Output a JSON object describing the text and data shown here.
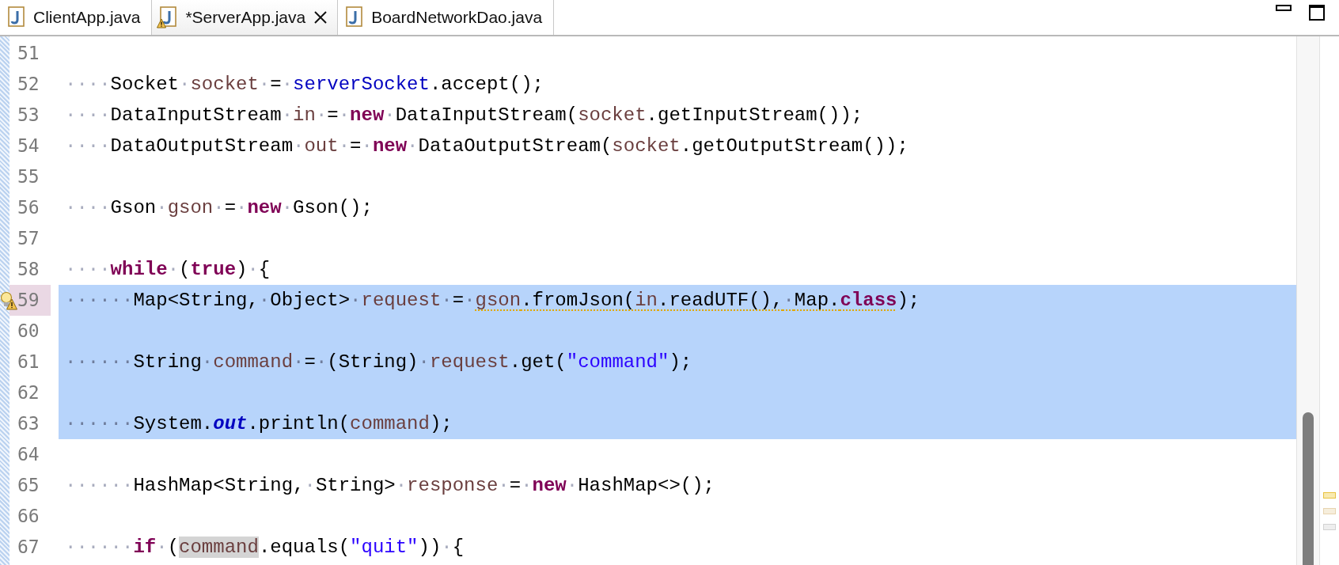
{
  "tabs": [
    {
      "label": "ClientApp.java",
      "selected": false,
      "warning": false
    },
    {
      "label": "*ServerApp.java",
      "selected": true,
      "warning": true
    },
    {
      "label": "BoardNetworkDao.java",
      "selected": false,
      "warning": false
    }
  ],
  "editor": {
    "lines": [
      {
        "number": "51",
        "selected": false,
        "warning": false
      },
      {
        "number": "52",
        "selected": false,
        "warning": false,
        "tokens": [
          {
            "kind": "ws",
            "text": "····"
          },
          {
            "kind": "plain",
            "text": "Socket"
          },
          {
            "kind": "ws",
            "text": "·"
          },
          {
            "kind": "local",
            "text": "socket"
          },
          {
            "kind": "ws",
            "text": "·"
          },
          {
            "kind": "plain",
            "text": "="
          },
          {
            "kind": "ws",
            "text": "·"
          },
          {
            "kind": "field",
            "text": "serverSocket"
          },
          {
            "kind": "plain",
            "text": ".accept();"
          }
        ]
      },
      {
        "number": "53",
        "selected": false,
        "warning": false,
        "tokens": [
          {
            "kind": "ws",
            "text": "····"
          },
          {
            "kind": "plain",
            "text": "DataInputStream"
          },
          {
            "kind": "ws",
            "text": "·"
          },
          {
            "kind": "local",
            "text": "in"
          },
          {
            "kind": "ws",
            "text": "·"
          },
          {
            "kind": "plain",
            "text": "="
          },
          {
            "kind": "ws",
            "text": "·"
          },
          {
            "kind": "keyword",
            "text": "new"
          },
          {
            "kind": "ws",
            "text": "·"
          },
          {
            "kind": "plain",
            "text": "DataInputStream("
          },
          {
            "kind": "local",
            "text": "socket"
          },
          {
            "kind": "plain",
            "text": ".getInputStream());"
          }
        ]
      },
      {
        "number": "54",
        "selected": false,
        "warning": false,
        "tokens": [
          {
            "kind": "ws",
            "text": "····"
          },
          {
            "kind": "plain",
            "text": "DataOutputStream"
          },
          {
            "kind": "ws",
            "text": "·"
          },
          {
            "kind": "local",
            "text": "out"
          },
          {
            "kind": "ws",
            "text": "·"
          },
          {
            "kind": "plain",
            "text": "="
          },
          {
            "kind": "ws",
            "text": "·"
          },
          {
            "kind": "keyword",
            "text": "new"
          },
          {
            "kind": "ws",
            "text": "·"
          },
          {
            "kind": "plain",
            "text": "DataOutputStream("
          },
          {
            "kind": "local",
            "text": "socket"
          },
          {
            "kind": "plain",
            "text": ".getOutputStream());"
          }
        ]
      },
      {
        "number": "55",
        "selected": false,
        "warning": false
      },
      {
        "number": "56",
        "selected": false,
        "warning": false,
        "tokens": [
          {
            "kind": "ws",
            "text": "····"
          },
          {
            "kind": "plain",
            "text": "Gson"
          },
          {
            "kind": "ws",
            "text": "·"
          },
          {
            "kind": "local",
            "text": "gson"
          },
          {
            "kind": "ws",
            "text": "·"
          },
          {
            "kind": "plain",
            "text": "="
          },
          {
            "kind": "ws",
            "text": "·"
          },
          {
            "kind": "keyword",
            "text": "new"
          },
          {
            "kind": "ws",
            "text": "·"
          },
          {
            "kind": "plain",
            "text": "Gson();"
          }
        ]
      },
      {
        "number": "57",
        "selected": false,
        "warning": false
      },
      {
        "number": "58",
        "selected": false,
        "warning": false,
        "tokens": [
          {
            "kind": "ws",
            "text": "····"
          },
          {
            "kind": "keyword",
            "text": "while"
          },
          {
            "kind": "ws",
            "text": "·"
          },
          {
            "kind": "plain",
            "text": "("
          },
          {
            "kind": "keyword",
            "text": "true"
          },
          {
            "kind": "plain",
            "text": ")"
          },
          {
            "kind": "ws",
            "text": "·"
          },
          {
            "kind": "plain",
            "text": "{"
          }
        ]
      },
      {
        "number": "59",
        "selected": true,
        "warning": true,
        "tokens": [
          {
            "kind": "ws",
            "text": "······"
          },
          {
            "kind": "plain",
            "text": "Map<String,"
          },
          {
            "kind": "ws",
            "text": "·"
          },
          {
            "kind": "plain",
            "text": "Object>"
          },
          {
            "kind": "ws",
            "text": "·"
          },
          {
            "kind": "local",
            "text": "request"
          },
          {
            "kind": "ws",
            "text": "·"
          },
          {
            "kind": "plain",
            "text": "="
          },
          {
            "kind": "ws",
            "text": "·"
          },
          {
            "kind": "warning",
            "tokens": [
              {
                "kind": "local",
                "text": "gson"
              },
              {
                "kind": "plain",
                "text": ".fromJson("
              },
              {
                "kind": "local",
                "text": "in"
              },
              {
                "kind": "plain",
                "text": ".readUTF(),"
              },
              {
                "kind": "ws",
                "text": "·"
              },
              {
                "kind": "plain",
                "text": "Map."
              },
              {
                "kind": "keyword",
                "text": "class"
              }
            ]
          },
          {
            "kind": "plain",
            "text": ");"
          }
        ]
      },
      {
        "number": "60",
        "selected": true,
        "warning": false
      },
      {
        "number": "61",
        "selected": true,
        "warning": false,
        "tokens": [
          {
            "kind": "ws",
            "text": "······"
          },
          {
            "kind": "plain",
            "text": "String"
          },
          {
            "kind": "ws",
            "text": "·"
          },
          {
            "kind": "local",
            "text": "command"
          },
          {
            "kind": "ws",
            "text": "·"
          },
          {
            "kind": "plain",
            "text": "="
          },
          {
            "kind": "ws",
            "text": "·"
          },
          {
            "kind": "plain",
            "text": "(String)"
          },
          {
            "kind": "ws",
            "text": "·"
          },
          {
            "kind": "local",
            "text": "request"
          },
          {
            "kind": "plain",
            "text": ".get("
          },
          {
            "kind": "string",
            "text": "\"command\""
          },
          {
            "kind": "plain",
            "text": ");"
          }
        ]
      },
      {
        "number": "62",
        "selected": true,
        "warning": false
      },
      {
        "number": "63",
        "selected": true,
        "warning": false,
        "tokens": [
          {
            "kind": "ws",
            "text": "······"
          },
          {
            "kind": "plain",
            "text": "System."
          },
          {
            "kind": "static",
            "text": "out"
          },
          {
            "kind": "plain",
            "text": ".println("
          },
          {
            "kind": "local",
            "text": "command"
          },
          {
            "kind": "plain",
            "text": ");"
          }
        ]
      },
      {
        "number": "64",
        "selected": false,
        "warning": false
      },
      {
        "number": "65",
        "selected": false,
        "warning": false,
        "tokens": [
          {
            "kind": "ws",
            "text": "······"
          },
          {
            "kind": "plain",
            "text": "HashMap<String,"
          },
          {
            "kind": "ws",
            "text": "·"
          },
          {
            "kind": "plain",
            "text": "String>"
          },
          {
            "kind": "ws",
            "text": "·"
          },
          {
            "kind": "local",
            "text": "response"
          },
          {
            "kind": "ws",
            "text": "·"
          },
          {
            "kind": "plain",
            "text": "="
          },
          {
            "kind": "ws",
            "text": "·"
          },
          {
            "kind": "keyword",
            "text": "new"
          },
          {
            "kind": "ws",
            "text": "·"
          },
          {
            "kind": "plain",
            "text": "HashMap<>();"
          }
        ]
      },
      {
        "number": "66",
        "selected": false,
        "warning": false
      },
      {
        "number": "67",
        "selected": false,
        "warning": false,
        "tokens": [
          {
            "kind": "ws",
            "text": "······"
          },
          {
            "kind": "keyword",
            "text": "if"
          },
          {
            "kind": "ws",
            "text": "·"
          },
          {
            "kind": "plain",
            "text": "("
          },
          {
            "kind": "occurrence",
            "text": "command"
          },
          {
            "kind": "plain",
            "text": ".equals("
          },
          {
            "kind": "string",
            "text": "\"quit\""
          },
          {
            "kind": "plain",
            "text": "))"
          },
          {
            "kind": "ws",
            "text": "·"
          },
          {
            "kind": "plain",
            "text": "{"
          }
        ]
      }
    ],
    "overview_markers": [
      {
        "kind": "warning"
      },
      {
        "kind": "occurrence"
      },
      {
        "kind": "annotation"
      }
    ]
  }
}
